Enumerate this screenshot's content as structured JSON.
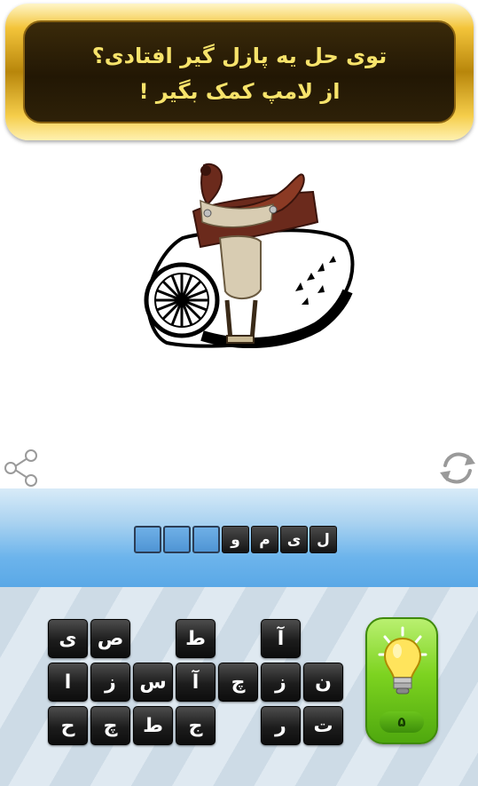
{
  "banner": {
    "line1": "توی حل یه پازل گیر افتادی؟",
    "line2": "از لامپ کمک بگیر !"
  },
  "puzzle": {
    "image": "saddle-image",
    "description_icon": "saddle"
  },
  "answer": {
    "slots": [
      {
        "letter": ""
      },
      {
        "letter": ""
      },
      {
        "letter": ""
      },
      {
        "letter": "و"
      },
      {
        "letter": "م"
      },
      {
        "letter": "ی"
      },
      {
        "letter": "ل"
      }
    ]
  },
  "keyboard": {
    "tiles": [
      {
        "id": "r1c1",
        "letter": "ی"
      },
      {
        "id": "r1c2",
        "letter": "ص"
      },
      {
        "id": "r1c4",
        "letter": "ط"
      },
      {
        "id": "r1c6",
        "letter": "آ"
      },
      {
        "id": "r2c1",
        "letter": "ا"
      },
      {
        "id": "r2c2",
        "letter": "ز"
      },
      {
        "id": "r2c3",
        "letter": "س"
      },
      {
        "id": "r2c4",
        "letter": "آ"
      },
      {
        "id": "r2c5",
        "letter": "چ"
      },
      {
        "id": "r2c6",
        "letter": "ز"
      },
      {
        "id": "r2c7",
        "letter": "ن"
      },
      {
        "id": "r3c1",
        "letter": "ح"
      },
      {
        "id": "r3c2",
        "letter": "چ"
      },
      {
        "id": "r3c3",
        "letter": "ط"
      },
      {
        "id": "r3c4",
        "letter": "ج"
      },
      {
        "id": "r3c6",
        "letter": "ر"
      },
      {
        "id": "r3c7",
        "letter": "ت"
      }
    ]
  },
  "hint": {
    "count": "۵",
    "icon": "lightbulb-icon"
  },
  "icons": {
    "share": "share-icon",
    "refresh": "refresh-icon"
  },
  "colors": {
    "banner_text": "#f7e36b",
    "gold_frame": "#d9a520",
    "band_blue": "#6cb4ec",
    "tile_black": "#1c1c1c",
    "hint_green": "#7dd320"
  }
}
